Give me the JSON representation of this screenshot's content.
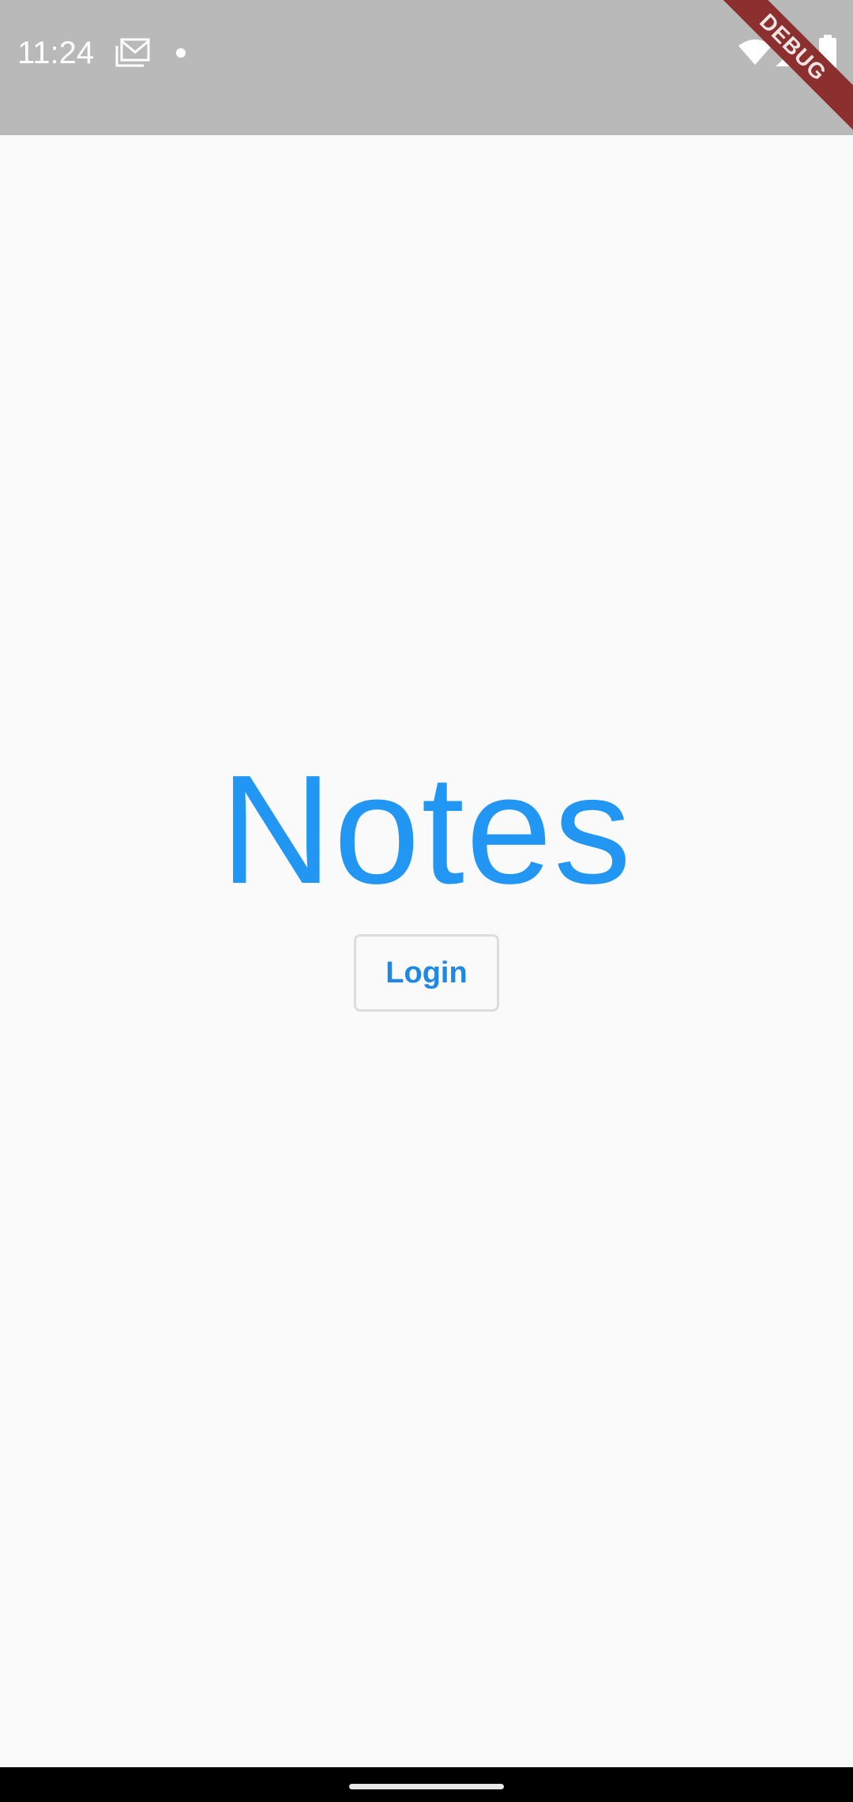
{
  "status_bar": {
    "time": "11:24",
    "icons": [
      "mail-icon",
      "notification-dot-icon",
      "wifi-icon",
      "cellular-signal-icon",
      "battery-icon"
    ],
    "background_color": "#b9b9b9"
  },
  "debug_banner": {
    "label": "DEBUG",
    "color": "#8b2f2f"
  },
  "main": {
    "title": "Notes",
    "login_label": "Login",
    "accent_color": "#2196f3"
  }
}
